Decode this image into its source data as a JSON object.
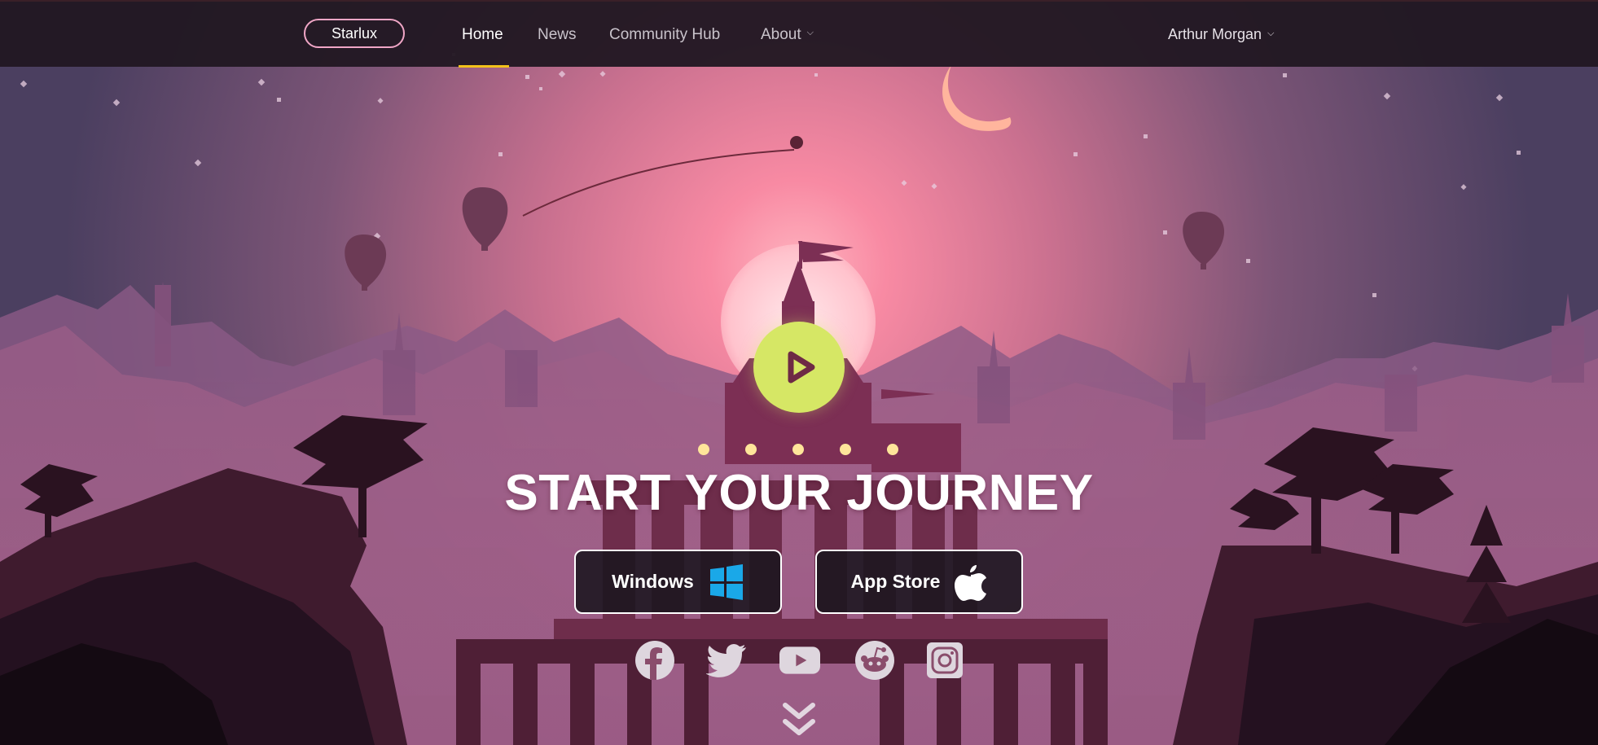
{
  "nav": {
    "brand": "Starlux",
    "links": [
      {
        "label": "Home",
        "active": true
      },
      {
        "label": "News",
        "active": false
      },
      {
        "label": "Community Hub",
        "active": false
      },
      {
        "label": "About",
        "active": false,
        "has_dropdown": true
      }
    ],
    "user_name": "Arthur Morgan"
  },
  "hero": {
    "headline": "START YOUR JOURNEY",
    "play_icon": "play-icon"
  },
  "downloads": [
    {
      "label": "Windows",
      "icon": "windows-icon"
    },
    {
      "label": "App Store",
      "icon": "apple-icon"
    }
  ],
  "social": [
    "facebook-icon",
    "twitter-icon",
    "youtube-icon",
    "reddit-icon",
    "instagram-icon"
  ],
  "scroll_indicator": "double-chevron-down-icon",
  "colors": {
    "accent_underline": "#f2c21b",
    "brand_border": "#f0a6c6",
    "play_button": "#d6e765",
    "sky_glow": "#f48aa5",
    "sky_top": "#4a3d5e",
    "social_icon": "#ded6de"
  }
}
